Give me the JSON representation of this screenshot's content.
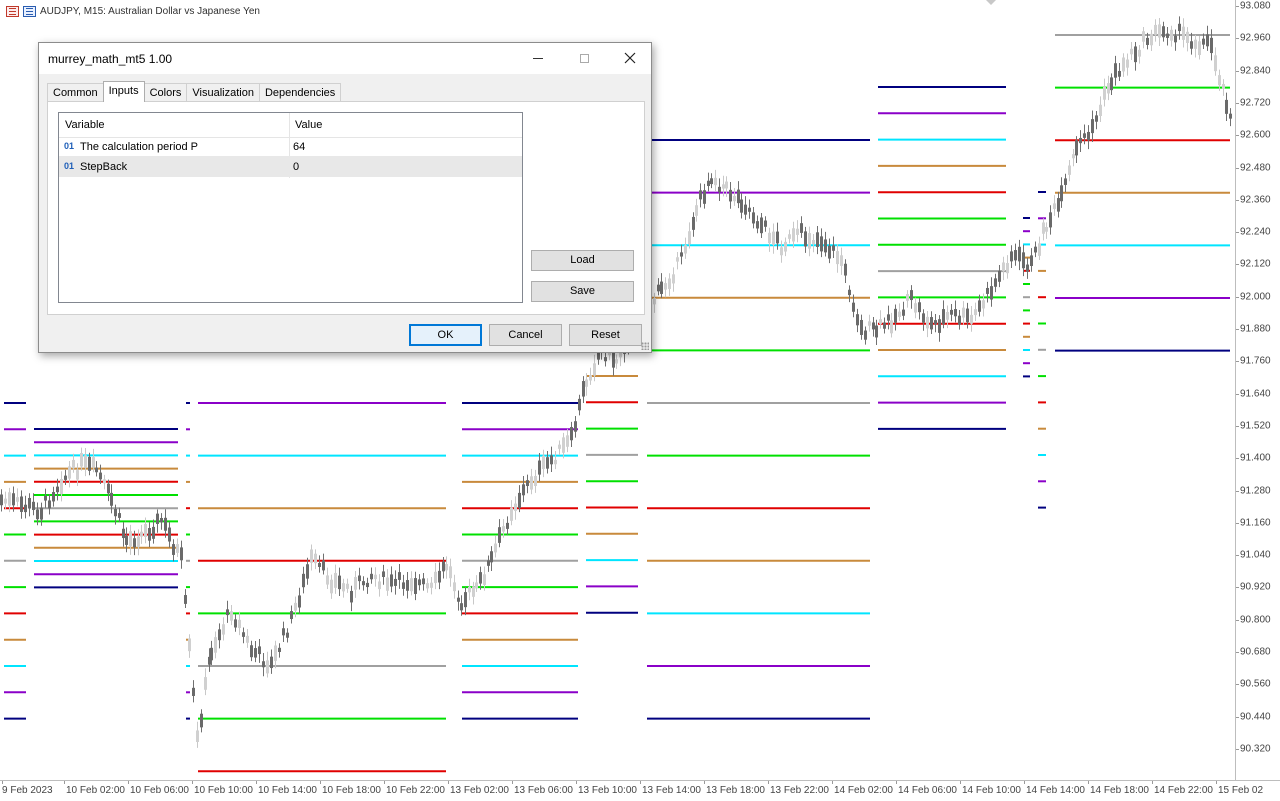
{
  "chart": {
    "symbol_header": "AUDJPY, M15:  Australian Dollar vs Japanese Yen",
    "price_labels": [
      "93.080",
      "92.960",
      "92.840",
      "92.720",
      "92.600",
      "92.480",
      "92.360",
      "92.240",
      "92.120",
      "92.000",
      "91.880",
      "91.760",
      "91.640",
      "91.520",
      "91.400",
      "91.280",
      "91.160",
      "91.040",
      "90.920",
      "90.800",
      "90.680",
      "90.560",
      "90.440",
      "90.320"
    ],
    "time_labels": [
      "9 Feb 2023",
      "10 Feb 02:00",
      "10 Feb 06:00",
      "10 Feb 10:00",
      "10 Feb 14:00",
      "10 Feb 18:00",
      "10 Feb 22:00",
      "13 Feb 02:00",
      "13 Feb 06:00",
      "13 Feb 10:00",
      "13 Feb 14:00",
      "13 Feb 18:00",
      "13 Feb 22:00",
      "14 Feb 02:00",
      "14 Feb 06:00",
      "14 Feb 10:00",
      "14 Feb 14:00",
      "14 Feb 18:00",
      "14 Feb 22:00",
      "15 Feb 02"
    ],
    "level_colors": {
      "navy": "#00007f",
      "purple": "#8a00c8",
      "cyan": "#00e5ff",
      "brown": "#c88a3c",
      "red": "#e00000",
      "green": "#00e000",
      "gray": "#a0a0a0"
    }
  },
  "dialog": {
    "title": "murrey_math_mt5 1.00",
    "tabs": [
      {
        "label": "Common"
      },
      {
        "label": "Inputs"
      },
      {
        "label": "Colors"
      },
      {
        "label": "Visualization"
      },
      {
        "label": "Dependencies"
      }
    ],
    "active_tab": "Inputs",
    "grid": {
      "headers": {
        "variable": "Variable",
        "value": "Value"
      },
      "rows": [
        {
          "type_icon": "01",
          "name": "The calculation period P",
          "value": "64"
        },
        {
          "type_icon": "01",
          "name": "StepBack",
          "value": "0"
        }
      ]
    },
    "buttons": {
      "load": "Load",
      "save": "Save",
      "ok": "OK",
      "cancel": "Cancel",
      "reset": "Reset"
    }
  }
}
